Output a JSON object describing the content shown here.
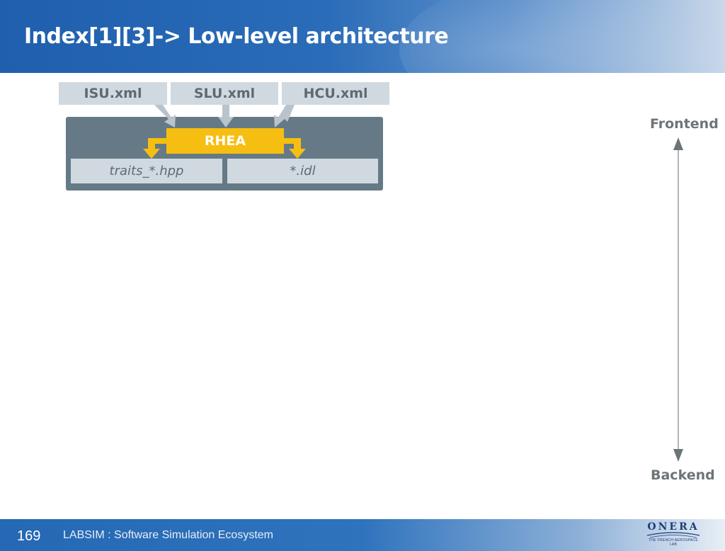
{
  "slide": {
    "title": "Index[1][3]-> Low-level architecture",
    "page_number": "169",
    "footer_text": "LABSIM : Software Simulation Ecosystem"
  },
  "diagram": {
    "inputs": [
      "ISU.xml",
      "SLU.xml",
      "HCU.xml"
    ],
    "processor": "RHEA",
    "outputs": [
      "traits_*.hpp",
      "*.idl"
    ]
  },
  "axis": {
    "top_label": "Frontend",
    "bottom_label": "Backend"
  },
  "logo": {
    "name": "ONERA",
    "tagline": "THE FRENCH AEROSPACE LAB"
  },
  "colors": {
    "header_blue": "#2a6cb8",
    "panel_slate": "#657a86",
    "box_grey": "#d1d9e0",
    "rhea_yellow": "#f7be12",
    "arrow_grey": "#6d7478"
  }
}
